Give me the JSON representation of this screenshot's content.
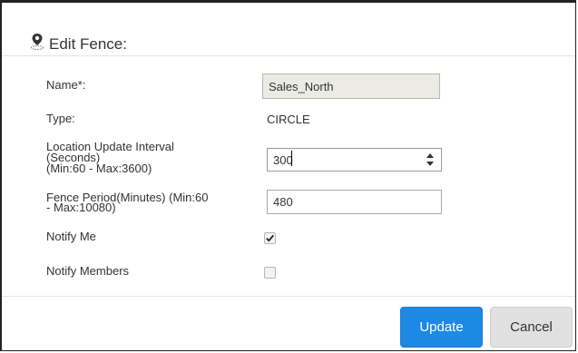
{
  "dialog": {
    "title": "Edit Fence:",
    "title_icon": "map-pin-icon"
  },
  "form": {
    "name_label": "Name*:",
    "name_value": "Sales_North",
    "type_label": "Type:",
    "type_value": "CIRCLE",
    "interval_label_line1": "Location Update Interval",
    "interval_label_line2": "(Seconds)",
    "interval_label_line3": "(Min:60 - Max:3600)",
    "interval_value": "300",
    "period_label_line1": "Fence Period(Minutes) (Min:60",
    "period_label_line2": "- Max:10080)",
    "period_value": "480",
    "notify_me_label": "Notify Me",
    "notify_me_checked": true,
    "notify_members_label": "Notify Members",
    "notify_members_checked": false
  },
  "buttons": {
    "update_label": "Update",
    "cancel_label": "Cancel"
  },
  "colors": {
    "primary": "#1e88e5",
    "secondary": "#e0e0e0",
    "readonly_bg": "#ebebe4"
  }
}
